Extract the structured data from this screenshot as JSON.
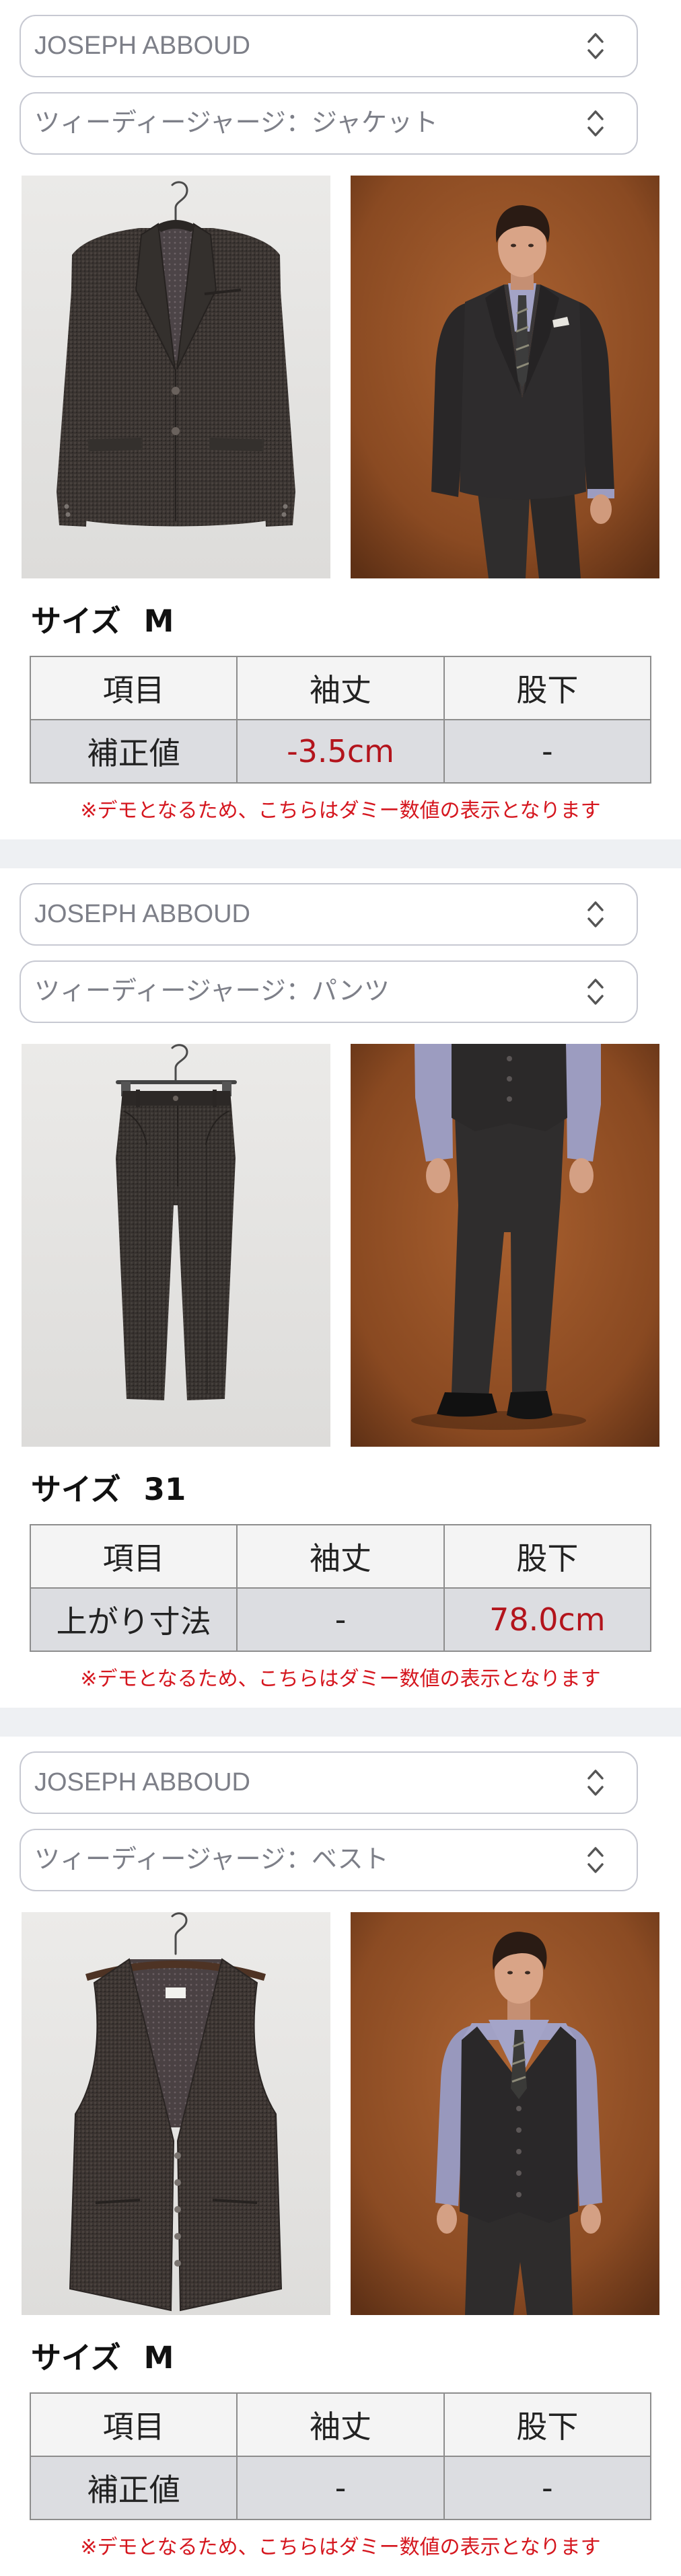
{
  "sections": [
    {
      "brand_select": "JOSEPH ABBOUD",
      "item_select": "ツィーディージャージ：ジャケット",
      "size_label": "サイズ",
      "size_value": "M",
      "table": {
        "headers": [
          "項目",
          "袖丈",
          "股下"
        ],
        "row": [
          "補正値",
          "-3.5cm",
          "-"
        ]
      },
      "note": "※デモとなるため、こちらはダミー数値の表示となります"
    },
    {
      "brand_select": "JOSEPH ABBOUD",
      "item_select": "ツィーディージャージ：パンツ",
      "size_label": "サイズ",
      "size_value": "31",
      "table": {
        "headers": [
          "項目",
          "袖丈",
          "股下"
        ],
        "row": [
          "上がり寸法",
          "-",
          "78.0cm"
        ]
      },
      "note": "※デモとなるため、こちらはダミー数値の表示となります"
    },
    {
      "brand_select": "JOSEPH ABBOUD",
      "item_select": "ツィーディージャージ：ベスト",
      "size_label": "サイズ",
      "size_value": "M",
      "table": {
        "headers": [
          "項目",
          "袖丈",
          "股下"
        ],
        "row": [
          "補正値",
          "-",
          "-"
        ]
      },
      "note": "※デモとなるため、こちらはダミー数値の表示となります"
    }
  ],
  "icons": {
    "select": "chevron-up-down-icon"
  },
  "colors": {
    "value_red": "#b3141c",
    "note_red": "#d5161e",
    "header_row": "#f4f4f4",
    "data_row": "#dcdde1",
    "select_border": "#c7c9d2"
  }
}
